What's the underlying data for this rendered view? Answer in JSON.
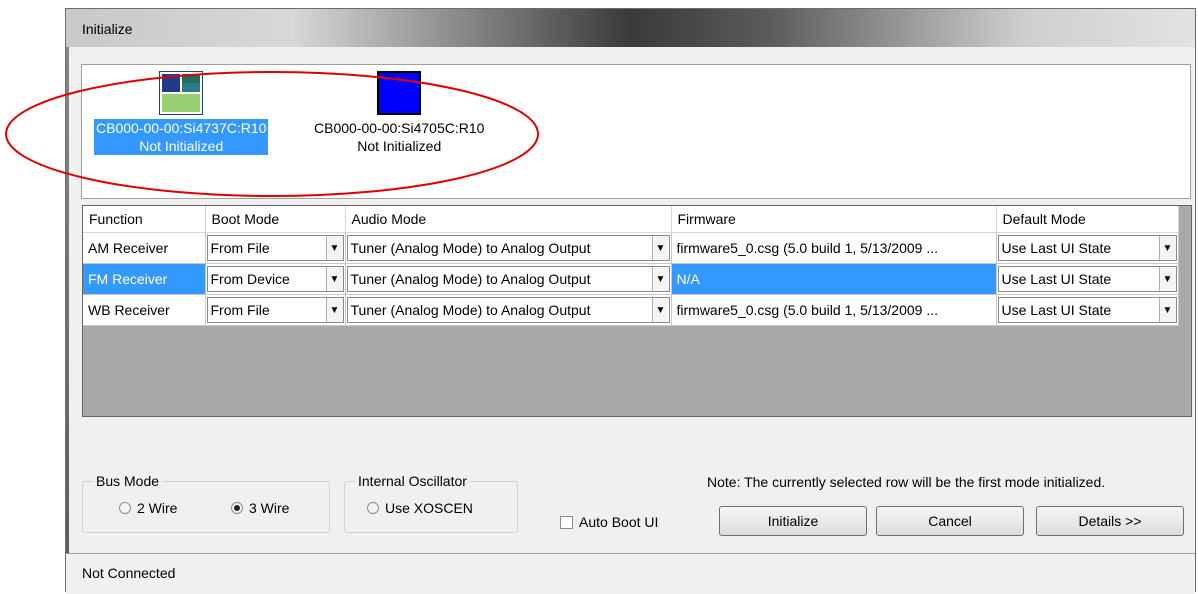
{
  "window": {
    "title": "Initialize"
  },
  "devices": [
    {
      "name": "CB000-00-00:Si4737C:R10",
      "status": "Not Initialized",
      "selected": true,
      "icon": "device-tiles-icon"
    },
    {
      "name": "CB000-00-00:Si4705C:R10",
      "status": "Not Initialized",
      "selected": false,
      "icon": "device-blue-icon"
    }
  ],
  "grid": {
    "headers": [
      "Function",
      "Boot Mode",
      "Audio Mode",
      "Firmware",
      "Default Mode"
    ],
    "rows": [
      {
        "function": "AM Receiver",
        "boot_mode": "From File",
        "audio_mode": "Tuner (Analog Mode) to Analog Output",
        "firmware": "firmware5_0.csg (5.0 build 1, 5/13/2009 ...",
        "default_mode": "Use Last UI State",
        "selected": false
      },
      {
        "function": "FM Receiver",
        "boot_mode": "From Device",
        "audio_mode": "Tuner (Analog Mode) to Analog Output",
        "firmware": "N/A",
        "default_mode": "Use Last UI State",
        "selected": true
      },
      {
        "function": "WB Receiver",
        "boot_mode": "From File",
        "audio_mode": "Tuner (Analog Mode) to Analog Output",
        "firmware": "firmware5_0.csg (5.0 build 1, 5/13/2009 ...",
        "default_mode": "Use Last UI State",
        "selected": false
      }
    ]
  },
  "bus_mode": {
    "label": "Bus Mode",
    "options": [
      "2 Wire",
      "3 Wire"
    ],
    "selected": "3 Wire"
  },
  "oscillator": {
    "label": "Internal Oscillator",
    "option": "Use XOSCEN",
    "selected": false
  },
  "auto_boot": {
    "label": "Auto Boot UI",
    "checked": false
  },
  "note": "Note: The currently selected row will be the first mode initialized.",
  "buttons": {
    "initialize": "Initialize",
    "cancel": "Cancel",
    "details": "Details >>"
  },
  "status_bar": "Not Connected",
  "colors": {
    "selection": "#3399ff",
    "annotation": "#e00000",
    "device_blue": "#0000ff",
    "tile_green": "#97cf73",
    "tile_teal": "#1e6e5a",
    "tile_navy": "#1e3c8c"
  }
}
